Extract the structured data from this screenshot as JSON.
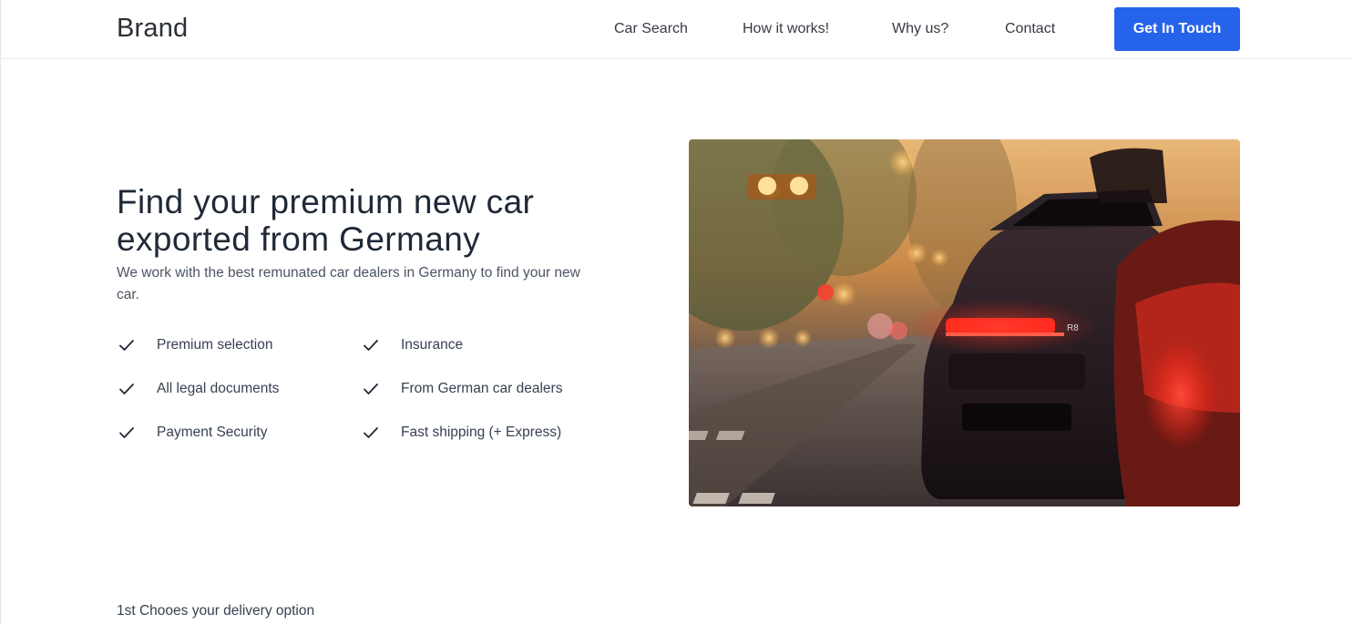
{
  "navbar": {
    "brand": "Brand",
    "links": [
      "Car Search",
      "How it works!",
      "Why us?",
      "Contact"
    ],
    "cta_label": "Get In Touch"
  },
  "hero": {
    "title_line1": "Find your premium new car",
    "title_line2": "exported from Germany",
    "subtitle": "We work with the best remunated car dealers in Germany to find your new car.",
    "features": [
      "Premium selection",
      "Insurance",
      "All legal documents",
      "From German car dealers",
      "Payment Security",
      "Fast shipping (+ Express)"
    ],
    "image": "photo of a dark sports car with red tail lights on a city street at dusk",
    "image_badge": "R8"
  },
  "next_section": {
    "heading": "1st Chooes your delivery option"
  },
  "colors": {
    "primary": "#2563eb",
    "text_dark": "#1f2937",
    "text_muted": "#4b5563"
  }
}
